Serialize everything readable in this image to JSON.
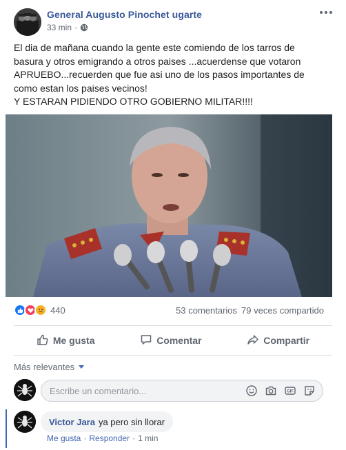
{
  "post": {
    "author": "General Augusto Pinochet ugarte",
    "time": "33 min",
    "separator": "·",
    "privacy_icon": "globe-icon",
    "more_icon": "more-options-icon",
    "text_lines": [
      "El dia de mañana cuando la gente este comiendo de los tarros de",
      "basura y otros emigrando a otros paises ...acuerdense que votaron",
      "APRUEBO...recuerden que fue asi uno de los pasos importantes de",
      "como estan los paises vecinos!",
      "Y ESTARAN PIDIENDO OTRO GOBIERNO MILITAR!!!!"
    ]
  },
  "stats": {
    "reaction_icons": [
      "like-reaction-icon",
      "love-reaction-icon",
      "sad-reaction-icon"
    ],
    "reaction_count": "440",
    "comments": "53 comentarios",
    "shares": "79 veces compartido"
  },
  "actions": {
    "like": "Me gusta",
    "comment": "Comentar",
    "share": "Compartir"
  },
  "comments_section": {
    "sort_label": "Más relevantes",
    "composer_placeholder": "Escribe un comentario...",
    "composer_icons": [
      "emoji-icon",
      "camera-icon",
      "gif-icon",
      "sticker-icon"
    ],
    "comments": [
      {
        "author": "Victor Jara",
        "text": "ya pero sin llorar",
        "like": "Me gusta",
        "reply": "Responder",
        "dot": "·",
        "time": "1 min"
      }
    ]
  },
  "colors": {
    "link_blue": "#385898",
    "accent_blue": "#4267b2",
    "secondary_text": "#606770",
    "divider": "#dadde1",
    "like_blue": "#1877f2",
    "love_red": "#f33e58",
    "sad_yellow": "#f7b125"
  }
}
